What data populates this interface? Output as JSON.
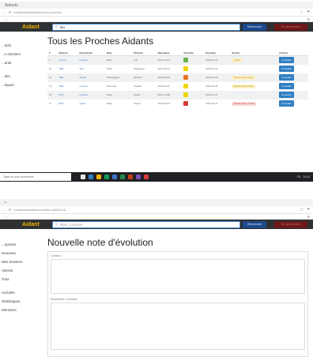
{
  "s1": {
    "browser": {
      "tab_title": "Aidants",
      "url": "localhost/aidants/tous-les-proches"
    },
    "header": {
      "brand": "Aidant",
      "search_value": "lou",
      "search_button": "Rechercher",
      "logout_button": "Se déconnecter"
    },
    "sidebar": [
      "...ntés",
      "...s dossiers",
      "...ante",
      "",
      "...ités",
      "...tiques"
    ],
    "page_title": "Tous les Proches Aidants",
    "table": {
      "headers": [
        "#",
        "Numéro",
        "Intervenant",
        "Nom",
        "Prénom",
        "Naissance",
        "Intensité",
        "Données",
        "Alertes",
        "Actions"
      ],
      "rows": [
        {
          "num": "6",
          "numero": "Lépine",
          "interv": "Lucrece",
          "nom": "Boile",
          "prenom": "Luc",
          "naiss": "2021-12-17",
          "imp": "#6ab04c",
          "date": "2021-07-20",
          "alert": "Actives",
          "alert_type": "warn"
        },
        {
          "num": "10",
          "numero": "TER",
          "interv": "Sofi",
          "nom": "Piche",
          "prenom": "Madeleine",
          "naiss": "2021-09-17",
          "imp": "#f0d400",
          "date": "2021-07-22",
          "alert": "",
          "alert_type": ""
        },
        {
          "num": "11",
          "numero": "TER",
          "interv": "Actuel",
          "nom": "Champagne",
          "prenom": "Richard",
          "naiss": "2021-08-03",
          "imp": "#e8742a",
          "date": "2021-07-20",
          "alert": "Plan de soins échoué",
          "alert_type": "warn"
        },
        {
          "num": "12",
          "numero": "TER",
          "interv": "Lucrece",
          "nom": "Dumoulin",
          "prenom": "Claude",
          "naiss": "2021-02-11",
          "imp": "#f0d400",
          "date": "2021-07-26",
          "alert": "Plan de soins échoué",
          "alert_type": "warn"
        },
        {
          "num": "15",
          "numero": "RTH",
          "interv": "Lucrece",
          "nom": "Aube",
          "prenom": "André",
          "naiss": "2021-12-08",
          "imp": "#f0d400",
          "date": "2021-07-27",
          "alert": "",
          "alert_type": ""
        },
        {
          "num": "17",
          "numero": "RTH",
          "interv": "Sylvie",
          "nom": "Dubé",
          "prenom": "Michel",
          "naiss": "2021-09-01",
          "imp": "#d93a3a",
          "date": "2021-07-27",
          "alert": "Dernière note > 1 mois",
          "alert_type": "danger"
        }
      ],
      "action_label": "Consulter"
    },
    "taskbar": {
      "search_placeholder": "Taper ici pour rechercher",
      "tray_lang": "FR",
      "tray_time": "10:43"
    }
  },
  "s2": {
    "browser": {
      "url": "localhost/aidants/nouvelle-note/id=18"
    },
    "header": {
      "brand": "Aidant",
      "search_placeholder": "Nom / prénom",
      "search_button": "Rechercher",
      "logout_button": "Se déconnecter"
    },
    "sidebar": [
      "...oposés",
      "Nouveau",
      "Mes dossiers",
      "Attente",
      "Tous",
      "",
      "Activités",
      "Statistiques",
      "Membres"
    ],
    "page_title": "Nouvelle note d'évolution",
    "form": {
      "label1": "Contenu",
      "label2": "Documents / annexes"
    }
  }
}
